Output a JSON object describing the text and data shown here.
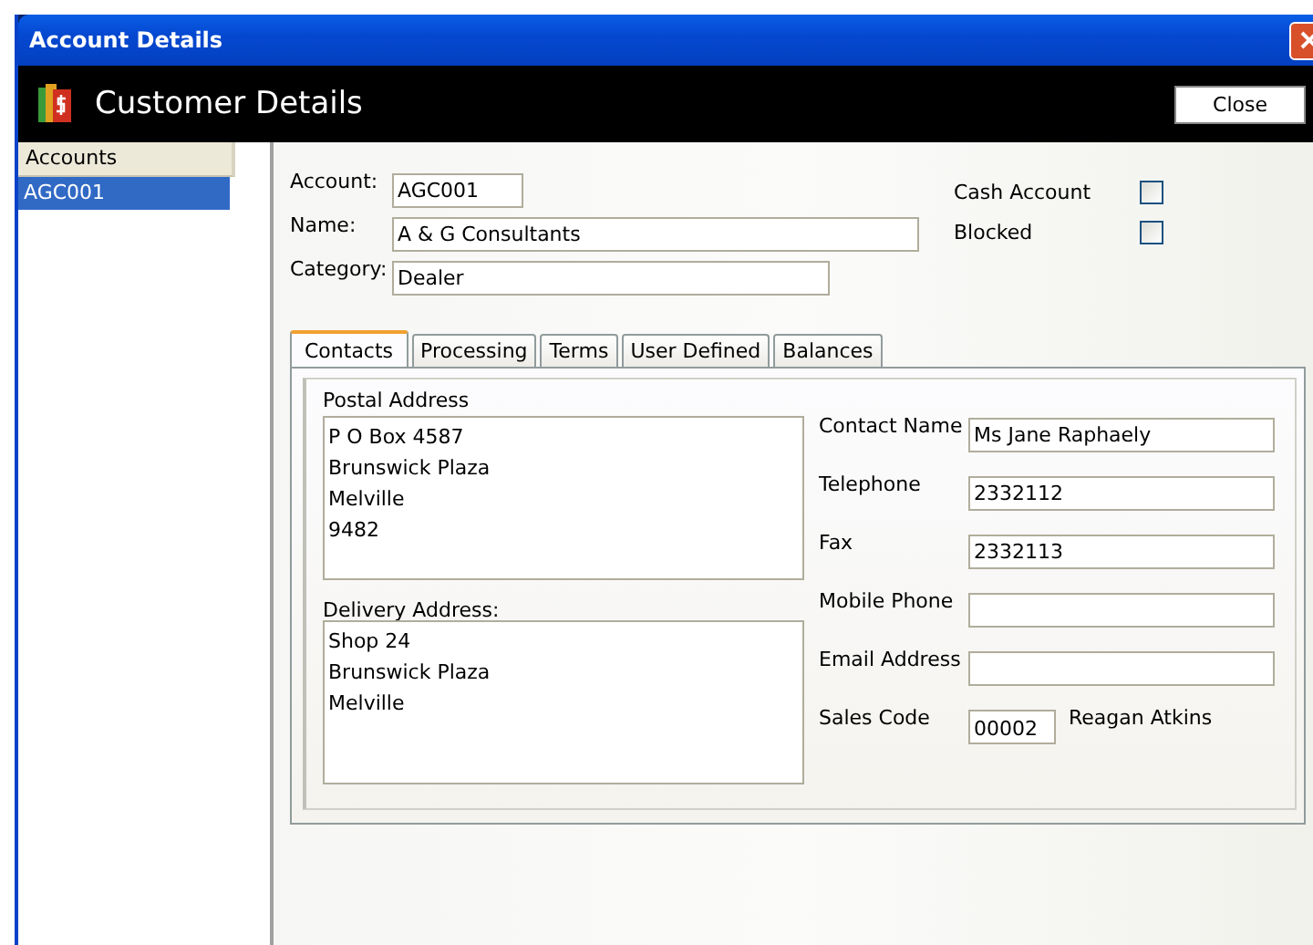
{
  "window": {
    "title": "Account Details"
  },
  "header": {
    "title": "Customer Details",
    "close_button": "Close"
  },
  "sidebar": {
    "heading": "Accounts",
    "items": [
      {
        "label": "AGC001",
        "selected": true
      }
    ]
  },
  "account": {
    "account_label": "Account:",
    "account": "AGC001",
    "name_label": "Name:",
    "name": "A & G Consultants",
    "category_label": "Category:",
    "category": "Dealer"
  },
  "flags": [
    {
      "label": "Cash Account",
      "checked": false
    },
    {
      "label": "Blocked",
      "checked": false
    }
  ],
  "tabs": [
    {
      "label": "Contacts",
      "selected": true
    },
    {
      "label": "Processing",
      "selected": false
    },
    {
      "label": "Terms",
      "selected": false
    },
    {
      "label": "User Defined",
      "selected": false
    },
    {
      "label": "Balances",
      "selected": false
    }
  ],
  "contacts": {
    "postal_label": "Postal Address",
    "postal_lines": [
      "P O Box 4587",
      "Brunswick Plaza",
      "Melville",
      "9482"
    ],
    "delivery_label": "Delivery Address:",
    "delivery_lines": [
      "Shop 24",
      "Brunswick Plaza",
      "Melville"
    ],
    "fields": [
      {
        "label": "Contact Name",
        "value": "Ms Jane Raphaely"
      },
      {
        "label": "Telephone",
        "value": "2332112"
      },
      {
        "label": "Fax",
        "value": "2332113"
      },
      {
        "label": "Mobile Phone"
      },
      {
        "label": "Email Address"
      }
    ],
    "sales_code_label": "Sales Code",
    "sales_code": "00002",
    "sales_rep": "Reagan Atkins"
  }
}
